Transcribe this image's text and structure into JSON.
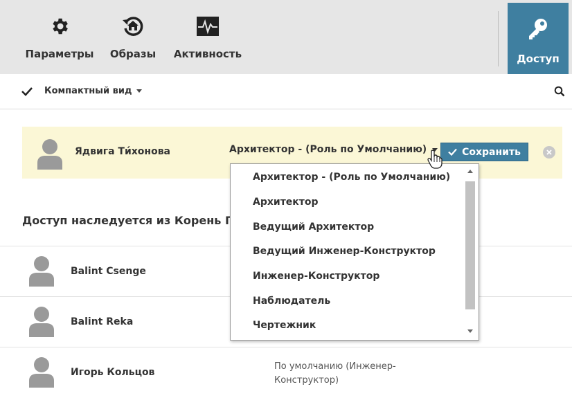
{
  "toolbar": {
    "items": [
      {
        "label": "Параметры",
        "icon": "gear-icon"
      },
      {
        "label": "Образы",
        "icon": "history-home-icon"
      },
      {
        "label": "Активность",
        "icon": "activity-pulse-icon"
      }
    ],
    "access": {
      "label": "Доступ",
      "icon": "key-icon"
    }
  },
  "subbar": {
    "compact_label": "Компактный вид",
    "check_icon": "check-icon",
    "search_icon": "search-icon"
  },
  "selected_user": {
    "name": "Ядвига Ти́хонова",
    "role": "Архитектор - (Роль по Умолчанию)",
    "save_label": "Сохранить"
  },
  "role_dropdown": {
    "options": [
      "Архитектор - (Роль по Умолчанию)",
      "Архитектор",
      "Ведущий Архитектор",
      "Ведущий Инженер-Конструктор",
      "Инженер-Конструктор",
      "Наблюдатель",
      "Чертежник"
    ]
  },
  "inherited": {
    "title": "Доступ наследуется из Корень Г",
    "users": [
      {
        "name": "Balint Csenge",
        "role": ""
      },
      {
        "name": "Balint Reka",
        "role": ""
      },
      {
        "name": "Игорь Кольцов",
        "role": "По умолчанию  (Инженер-Конструктор)"
      }
    ]
  },
  "colors": {
    "toolbar_bg": "#e6e6e6",
    "accent": "#3f7fa0",
    "selected_row_bg": "#fbf7d6"
  }
}
